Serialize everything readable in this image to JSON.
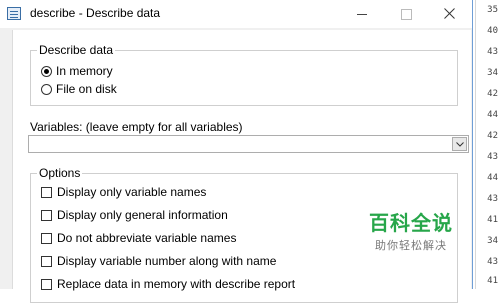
{
  "background": {
    "row_numbers": [
      "35",
      "40",
      "43",
      "34",
      "42",
      "44",
      "42",
      "43",
      "44",
      "43",
      "41",
      "34",
      "43",
      "41"
    ]
  },
  "window": {
    "title": "describe - Describe data",
    "minimize_icon": "minimize-icon",
    "maximize_icon": "maximize-icon",
    "close_icon": "close-icon",
    "accent_color": "#6f9ed6"
  },
  "describe_group": {
    "legend": "Describe data",
    "options": [
      {
        "label": "In memory",
        "checked": true
      },
      {
        "label": "File on disk",
        "checked": false
      }
    ]
  },
  "variables": {
    "label": "Variables: (leave empty for all variables)",
    "value": "",
    "dropdown_icon": "chevron-down-icon"
  },
  "options_group": {
    "legend": "Options",
    "items": [
      {
        "label": "Display only variable names",
        "checked": false
      },
      {
        "label": "Display only general information",
        "checked": false
      },
      {
        "label": "Do not abbreviate variable names",
        "checked": false
      },
      {
        "label": "Display variable number along with name",
        "checked": false
      },
      {
        "label": "Replace data in memory with describe report",
        "checked": false
      }
    ]
  },
  "watermark": {
    "main": "百科全说",
    "sub": "助你轻松解决",
    "color": "#27a64a"
  }
}
